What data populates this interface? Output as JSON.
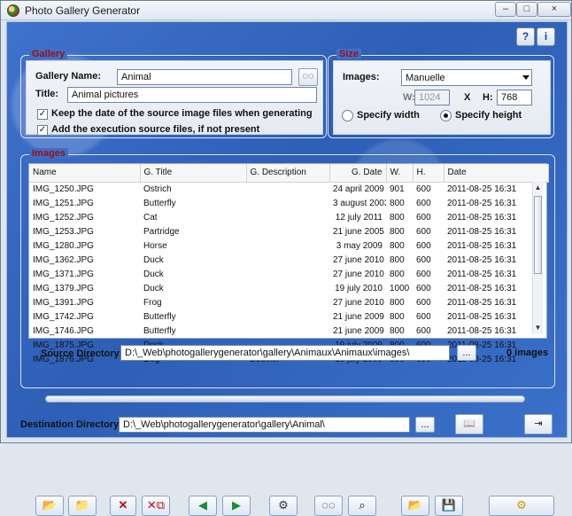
{
  "window": {
    "title": "Photo Gallery Generator",
    "help_icon_1": "help-circle-icon",
    "help_icon_2": "info-icon"
  },
  "gallery": {
    "title": "Gallery",
    "name_label": "Gallery Name:",
    "name_value": "Animal",
    "title_label": "Title:",
    "title_value": "Animal pictures",
    "keep_date_label": "Keep the date of the source image files when generating",
    "add_source_label": "Add the execution source files, if not present"
  },
  "size": {
    "title": "Size",
    "images_label": "Images:",
    "images_value": "Manuelle",
    "width_label": "W:",
    "width_value": "1024",
    "x_label": "X",
    "height_label": "H:",
    "height_value": "768",
    "specify_width_label": "Specify width",
    "specify_height_label": "Specify height"
  },
  "images": {
    "title": "Images",
    "columns": [
      "Name",
      "G. Title",
      "G. Description",
      "G. Date",
      "W.",
      "H.",
      "Date"
    ],
    "rows": [
      [
        "IMG_1250.JPG",
        "Ostrich",
        "",
        "24 april 2009",
        "901",
        "600",
        "2011-08-25 16:31"
      ],
      [
        "IMG_1251.JPG",
        "Butterfly",
        "",
        "3 august 2003",
        "800",
        "600",
        "2011-08-25 16:31"
      ],
      [
        "IMG_1252.JPG",
        "Cat",
        "",
        "12 july 2011",
        "800",
        "600",
        "2011-08-25 16:31"
      ],
      [
        "IMG_1253.JPG",
        "Partridge",
        "",
        "21 june 2005",
        "800",
        "600",
        "2011-08-25 16:31"
      ],
      [
        "IMG_1280.JPG",
        "Horse",
        "",
        "3 may 2009",
        "800",
        "600",
        "2011-08-25 16:31"
      ],
      [
        "IMG_1362.JPG",
        "Duck",
        "",
        "27 june 2010",
        "800",
        "600",
        "2011-08-25 16:31"
      ],
      [
        "IMG_1371.JPG",
        "Duck",
        "",
        "27 june 2010",
        "800",
        "600",
        "2011-08-25 16:31"
      ],
      [
        "IMG_1379.JPG",
        "Duck",
        "",
        "19 july 2010",
        "1000",
        "600",
        "2011-08-25 16:31"
      ],
      [
        "IMG_1391.JPG",
        "Frog",
        "",
        "27 june 2010",
        "800",
        "600",
        "2011-08-25 16:31"
      ],
      [
        "IMG_1742.JPG",
        "Butterfly",
        "",
        "21 june 2009",
        "800",
        "600",
        "2011-08-25 16:31"
      ],
      [
        "IMG_1746.JPG",
        "Butterfly",
        "",
        "21 june 2009",
        "800",
        "600",
        "2011-08-25 16:31"
      ],
      [
        "IMG_1875.JPG",
        "Dock",
        "",
        "19 july 2009",
        "800",
        "600",
        "2011-08-25 16:31"
      ],
      [
        "IMG_1876.JPG",
        "Dog",
        "Bouvier",
        "19 july 2009",
        "800",
        "600",
        "2011-08-25 16:31"
      ]
    ],
    "source_label": "Source Directory:",
    "source_value": "D:\\_Web\\photogallerygenerator\\gallery\\Animaux\\Animaux\\images\\",
    "browse_label": "...",
    "count_text": "0 images"
  },
  "toolbar": {
    "buttons": [
      "open-folder-icon",
      "new-folder-icon",
      "delete-icon",
      "delete-copy-icon",
      "left-arrow-icon",
      "right-arrow-icon",
      "settings-icon",
      "glasses-icon",
      "search-icon",
      "folder-icon",
      "save-icon",
      "generate-gear-icon"
    ]
  },
  "destination": {
    "label": "Destination Directory:",
    "value": "D:\\_Web\\photogallerygenerator\\gallery\\Animal\\",
    "browse_label": "..."
  }
}
